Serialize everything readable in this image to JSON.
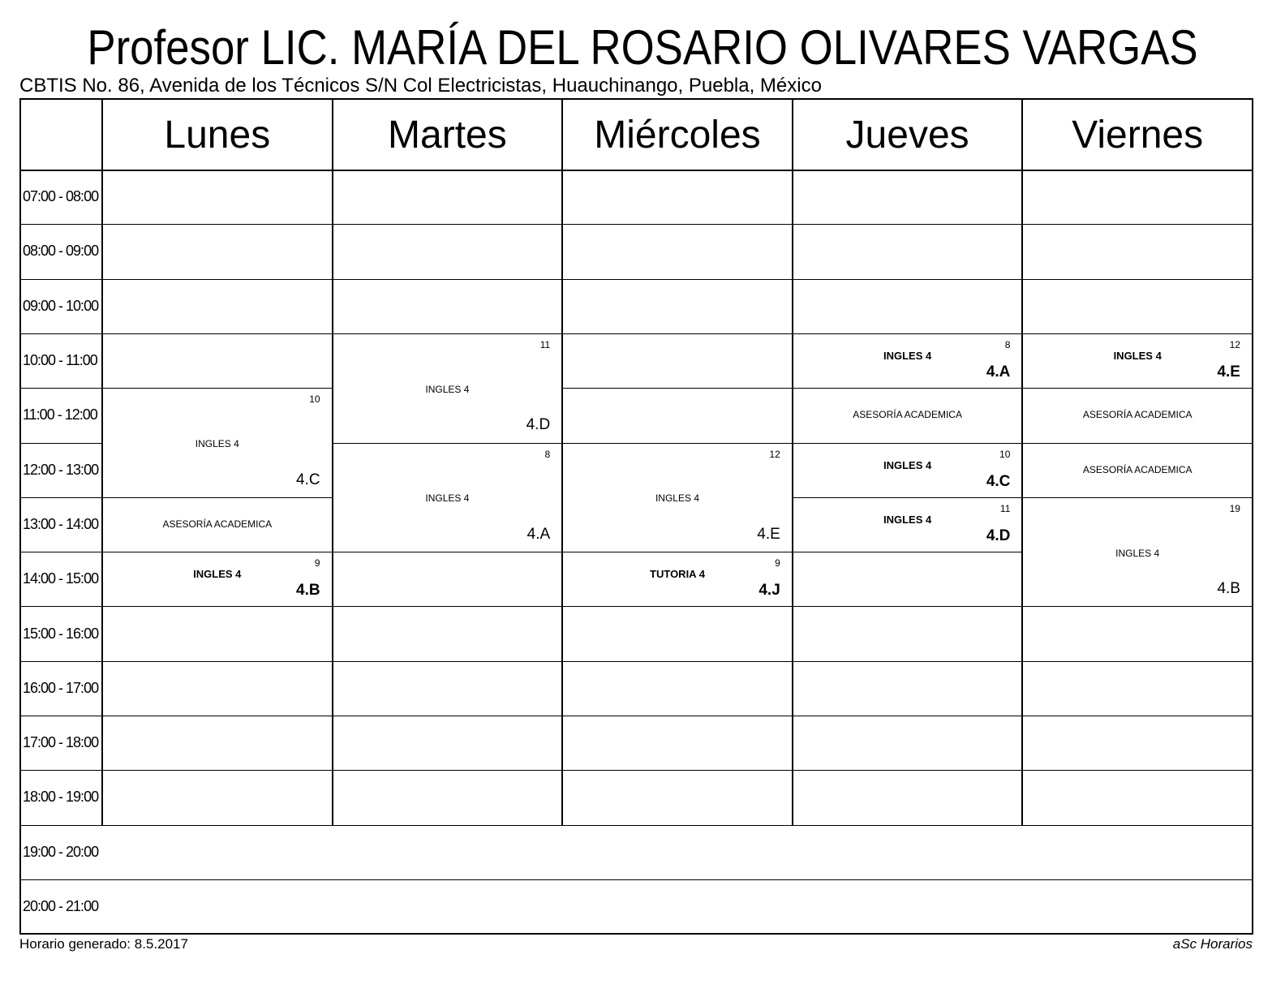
{
  "title": "Profesor LIC. MARÍA DEL ROSARIO OLIVARES VARGAS",
  "subtitle": "CBTIS No. 86, Avenida de los Técnicos S/N Col Electricistas, Huauchinango, Puebla, México",
  "days": [
    "Lunes",
    "Martes",
    "Miércoles",
    "Jueves",
    "Viernes"
  ],
  "times": [
    "07:00 - 08:00",
    "08:00 - 09:00",
    "09:00 - 10:00",
    "10:00 - 11:00",
    "11:00 - 12:00",
    "12:00 - 13:00",
    "13:00 - 14:00",
    "14:00 - 15:00",
    "15:00 - 16:00",
    "16:00 - 17:00",
    "17:00 - 18:00",
    "18:00 - 19:00",
    "19:00 - 20:00",
    "20:00 - 21:00"
  ],
  "lessons": [
    {
      "day": 0,
      "start": 4,
      "span": 2,
      "num": "10",
      "subject": "INGLES 4",
      "group": "4.C",
      "bold": false
    },
    {
      "day": 0,
      "start": 6,
      "span": 1,
      "num": "",
      "subject": "ASESORÍA ACADEMICA",
      "group": "",
      "bold": false
    },
    {
      "day": 0,
      "start": 7,
      "span": 1,
      "num": "9",
      "subject": "INGLES 4",
      "group": "4.B",
      "bold": true
    },
    {
      "day": 1,
      "start": 3,
      "span": 2,
      "num": "11",
      "subject": "INGLES 4",
      "group": "4.D",
      "bold": false
    },
    {
      "day": 1,
      "start": 5,
      "span": 2,
      "num": "8",
      "subject": "INGLES 4",
      "group": "4.A",
      "bold": false
    },
    {
      "day": 2,
      "start": 5,
      "span": 2,
      "num": "12",
      "subject": "INGLES 4",
      "group": "4.E",
      "bold": false
    },
    {
      "day": 2,
      "start": 7,
      "span": 1,
      "num": "9",
      "subject": "TUTORIA 4",
      "group": "4.J",
      "bold": true
    },
    {
      "day": 3,
      "start": 3,
      "span": 1,
      "num": "8",
      "subject": "INGLES 4",
      "group": "4.A",
      "bold": true
    },
    {
      "day": 3,
      "start": 4,
      "span": 1,
      "num": "",
      "subject": "ASESORÍA ACADEMICA",
      "group": "",
      "bold": false
    },
    {
      "day": 3,
      "start": 5,
      "span": 1,
      "num": "10",
      "subject": "INGLES 4",
      "group": "4.C",
      "bold": true
    },
    {
      "day": 3,
      "start": 6,
      "span": 1,
      "num": "11",
      "subject": "INGLES 4",
      "group": "4.D",
      "bold": true
    },
    {
      "day": 4,
      "start": 3,
      "span": 1,
      "num": "12",
      "subject": "INGLES 4",
      "group": "4.E",
      "bold": true
    },
    {
      "day": 4,
      "start": 4,
      "span": 1,
      "num": "",
      "subject": "ASESORÍA ACADEMICA",
      "group": "",
      "bold": false
    },
    {
      "day": 4,
      "start": 5,
      "span": 1,
      "num": "",
      "subject": "ASESORÍA ACADEMICA",
      "group": "",
      "bold": false
    },
    {
      "day": 4,
      "start": 6,
      "span": 2,
      "num": "19",
      "subject": "INGLES 4",
      "group": "4.B",
      "bold": false
    }
  ],
  "footer_left": "Horario generado: 8.5.2017",
  "footer_right": "aSc Horarios"
}
